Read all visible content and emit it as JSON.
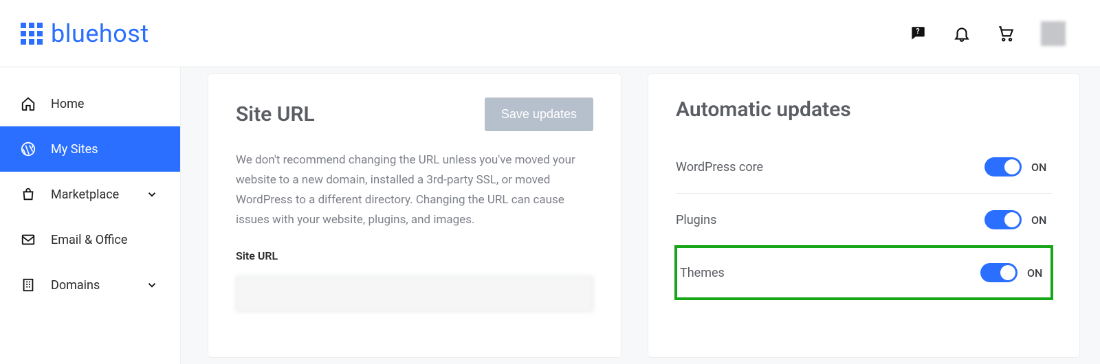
{
  "brand": {
    "name": "bluehost"
  },
  "header_icons": {
    "help": "help-chat-icon",
    "bell": "bell-icon",
    "cart": "cart-icon",
    "avatar": "avatar"
  },
  "sidebar": {
    "items": [
      {
        "label": "Home",
        "icon": "home-icon",
        "has_chevron": false
      },
      {
        "label": "My Sites",
        "icon": "wordpress-icon",
        "has_chevron": false,
        "active": true
      },
      {
        "label": "Marketplace",
        "icon": "bag-icon",
        "has_chevron": true
      },
      {
        "label": "Email & Office",
        "icon": "mail-icon",
        "has_chevron": false
      },
      {
        "label": "Domains",
        "icon": "building-icon",
        "has_chevron": true
      }
    ]
  },
  "site_url_card": {
    "title": "Site URL",
    "save_label": "Save updates",
    "description": "We don't recommend changing the URL unless you've moved your website to a new domain, installed a 3rd-party SSL, or moved WordPress to a different directory. Changing the URL can cause issues with your website, plugins, and images.",
    "field_label": "Site URL",
    "input_value": ""
  },
  "auto_updates_card": {
    "title": "Automatic updates",
    "rows": [
      {
        "label": "WordPress core",
        "state": "ON"
      },
      {
        "label": "Plugins",
        "state": "ON"
      },
      {
        "label": "Themes",
        "state": "ON",
        "highlight": true
      }
    ]
  }
}
